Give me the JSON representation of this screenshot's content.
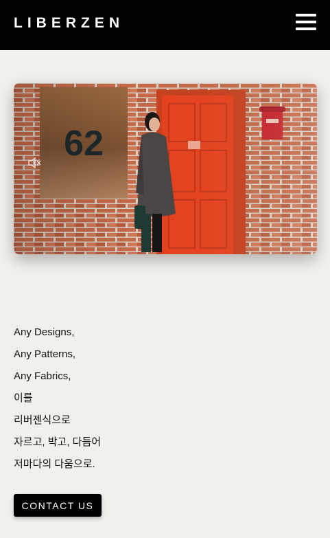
{
  "header": {
    "logo": "LIBERZEN",
    "menu_icon": "hamburger-menu-icon"
  },
  "hero": {
    "door_sign_number": "62",
    "mute_icon": "speaker-muted-icon",
    "colors": {
      "brick": "#c8704f",
      "door": "#e8431e",
      "plaque": "#8a5a35"
    }
  },
  "copy": {
    "lines": [
      "Any Designs,",
      "Any Patterns,",
      "Any Fabrics,",
      "이를",
      "리버젠식으로",
      "자르고, 박고, 다듬어",
      "저마다의 다움으로."
    ]
  },
  "cta": {
    "label": "CONTACT US"
  },
  "colors": {
    "header_bg": "#000000",
    "page_bg": "#f2f0ec",
    "button_bg": "#000000",
    "button_text": "#ffffff"
  }
}
